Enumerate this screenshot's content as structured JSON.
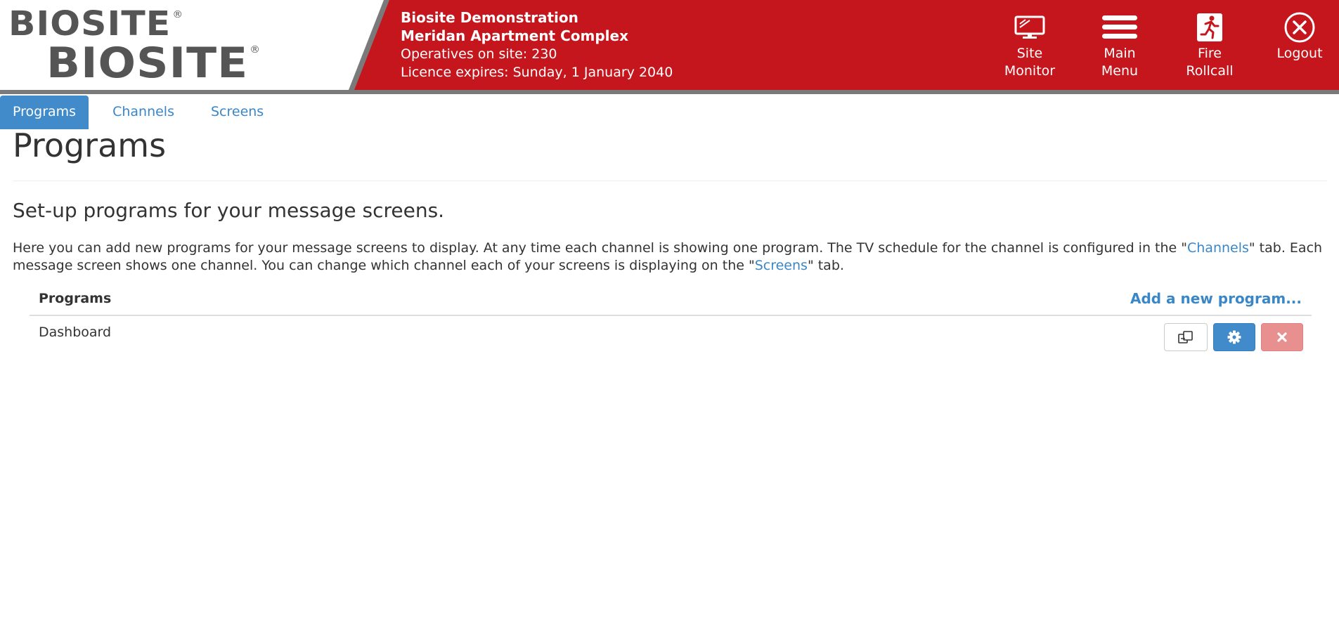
{
  "header": {
    "logo_top": "BIOSITE",
    "logo_bottom": "BIOSITE",
    "logo_reg": "®",
    "site_name": "Biosite Demonstration",
    "site_location": "Meridan Apartment Complex",
    "operatives": "Operatives on site: 230",
    "licence": "Licence expires: Sunday, 1 January 2040",
    "buttons": {
      "site_monitor": "Site\nMonitor",
      "main_menu": "Main\nMenu",
      "fire_rollcall": "Fire\nRollcall",
      "logout": "Logout"
    },
    "colors": {
      "brand_red": "#c4161c",
      "logo_grey": "#555555"
    }
  },
  "tabs": [
    {
      "label": "Programs",
      "active": true
    },
    {
      "label": "Channels",
      "active": false
    },
    {
      "label": "Screens",
      "active": false
    }
  ],
  "main": {
    "title": "Programs",
    "subtitle": "Set-up programs for your message screens.",
    "description": {
      "part1": "Here you can add new programs for your message screens to display. At any time each channel is showing one program. The TV schedule for the channel is configured in the \"",
      "link1": "Channels",
      "part2": "\" tab. Each message screen shows one channel. You can change which channel each of your screens is displaying on the \"",
      "link2": "Screens",
      "part3": "\" tab."
    },
    "table": {
      "header": "Programs",
      "add_link": "Add a new program...",
      "rows": [
        {
          "name": "Dashboard"
        }
      ]
    }
  },
  "icons": {
    "site_monitor": "monitor-icon",
    "main_menu": "hamburger-icon",
    "fire_rollcall": "fire-exit-icon",
    "logout": "close-circle-icon",
    "copy": "copy-icon",
    "settings": "gear-icon",
    "delete": "close-icon"
  },
  "accent": "#428bca"
}
